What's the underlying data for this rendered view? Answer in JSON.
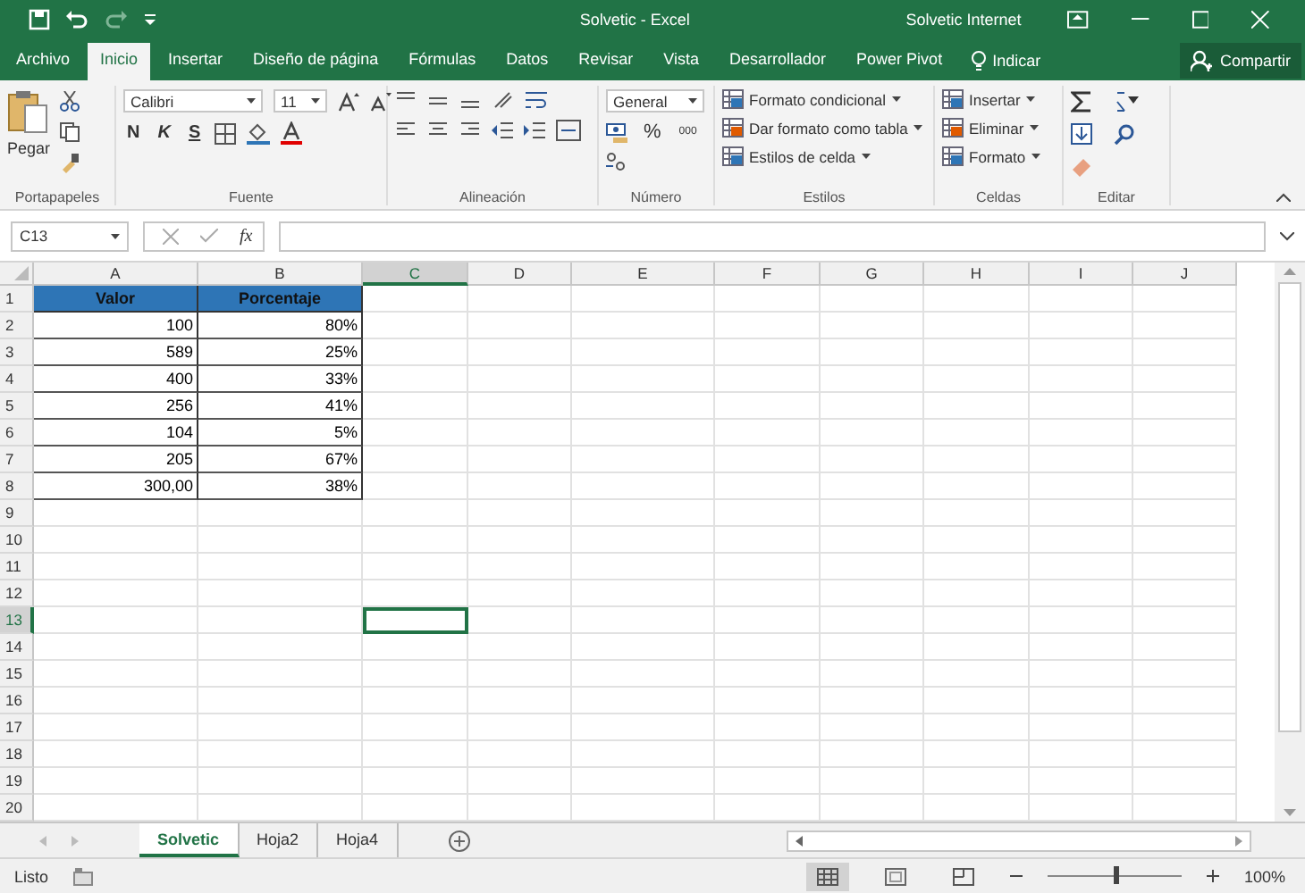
{
  "window": {
    "title": "Solvetic  -  Excel",
    "account": "Solvetic Internet"
  },
  "tabs": [
    {
      "label": "Archivo",
      "selected": false
    },
    {
      "label": "Inicio",
      "selected": true
    },
    {
      "label": "Insertar",
      "selected": false
    },
    {
      "label": "Diseño de página",
      "selected": false
    },
    {
      "label": "Fórmulas",
      "selected": false
    },
    {
      "label": "Datos",
      "selected": false
    },
    {
      "label": "Revisar",
      "selected": false
    },
    {
      "label": "Vista",
      "selected": false
    },
    {
      "label": "Desarrollador",
      "selected": false
    },
    {
      "label": "Power Pivot",
      "selected": false
    }
  ],
  "tell_me": "Indicar",
  "share": "Compartir",
  "ribbon": {
    "groups": [
      {
        "kind": "clipboard",
        "label": "Portapapeles",
        "paste": "Pegar"
      },
      {
        "kind": "font",
        "label": "Fuente",
        "font": "Calibri",
        "size": "11",
        "bold": "N",
        "italic": "K",
        "underline": "S"
      },
      {
        "kind": "alignment",
        "label": "Alineación"
      },
      {
        "kind": "number",
        "label": "Número",
        "format": "General",
        "percent": "%",
        "thousands": "000"
      },
      {
        "kind": "list",
        "label": "Estilos",
        "items": [
          "Formato condicional",
          "Dar formato como tabla",
          "Estilos de celda"
        ]
      },
      {
        "kind": "list",
        "label": "Celdas",
        "items": [
          "Insertar",
          "Eliminar",
          "Formato"
        ]
      },
      {
        "kind": "editing",
        "label": "Editar"
      }
    ]
  },
  "formula_bar": {
    "name_box": "C13",
    "fx": "fx"
  },
  "grid": {
    "columns": [
      {
        "label": "A",
        "selected": false
      },
      {
        "label": "B",
        "selected": false
      },
      {
        "label": "C",
        "selected": true
      },
      {
        "label": "D",
        "selected": false
      },
      {
        "label": "E",
        "selected": false
      },
      {
        "label": "F",
        "selected": false
      },
      {
        "label": "G",
        "selected": false
      },
      {
        "label": "H",
        "selected": false
      },
      {
        "label": "I",
        "selected": false
      },
      {
        "label": "J",
        "selected": false
      }
    ],
    "rows": [
      {
        "number": "1",
        "selected": false,
        "kind": "header",
        "cells": [
          "Valor",
          "Porcentaje"
        ]
      },
      {
        "number": "2",
        "selected": false,
        "kind": "data",
        "cells": [
          "100",
          "80%"
        ]
      },
      {
        "number": "3",
        "selected": false,
        "kind": "data",
        "cells": [
          "589",
          "25%"
        ]
      },
      {
        "number": "4",
        "selected": false,
        "kind": "data",
        "cells": [
          "400",
          "33%"
        ]
      },
      {
        "number": "5",
        "selected": false,
        "kind": "data",
        "cells": [
          "256",
          "41%"
        ]
      },
      {
        "number": "6",
        "selected": false,
        "kind": "data",
        "cells": [
          "104",
          "5%"
        ]
      },
      {
        "number": "7",
        "selected": false,
        "kind": "data",
        "cells": [
          "205",
          "67%"
        ]
      },
      {
        "number": "8",
        "selected": false,
        "kind": "data",
        "cells": [
          "300,00",
          "38%"
        ]
      },
      {
        "number": "9",
        "selected": false,
        "kind": "empty",
        "cells": []
      },
      {
        "number": "10",
        "selected": false,
        "kind": "empty",
        "cells": []
      },
      {
        "number": "11",
        "selected": false,
        "kind": "empty",
        "cells": []
      },
      {
        "number": "12",
        "selected": false,
        "kind": "empty",
        "cells": []
      },
      {
        "number": "13",
        "selected": true,
        "kind": "empty",
        "cells": []
      },
      {
        "number": "14",
        "selected": false,
        "kind": "empty",
        "cells": []
      },
      {
        "number": "15",
        "selected": false,
        "kind": "empty",
        "cells": []
      },
      {
        "number": "16",
        "selected": false,
        "kind": "empty",
        "cells": []
      },
      {
        "number": "17",
        "selected": false,
        "kind": "empty",
        "cells": []
      },
      {
        "number": "18",
        "selected": false,
        "kind": "empty",
        "cells": []
      },
      {
        "number": "19",
        "selected": false,
        "kind": "empty",
        "cells": []
      },
      {
        "number": "20",
        "selected": false,
        "kind": "empty",
        "cells": []
      }
    ]
  },
  "sheets": [
    {
      "label": "Solvetic",
      "selected": true
    },
    {
      "label": "Hoja2",
      "selected": false
    },
    {
      "label": "Hoja4",
      "selected": false
    }
  ],
  "status_bar": {
    "status": "Listo",
    "zoom": "100%",
    "zoom_slider": {
      "level": 0.5
    }
  }
}
